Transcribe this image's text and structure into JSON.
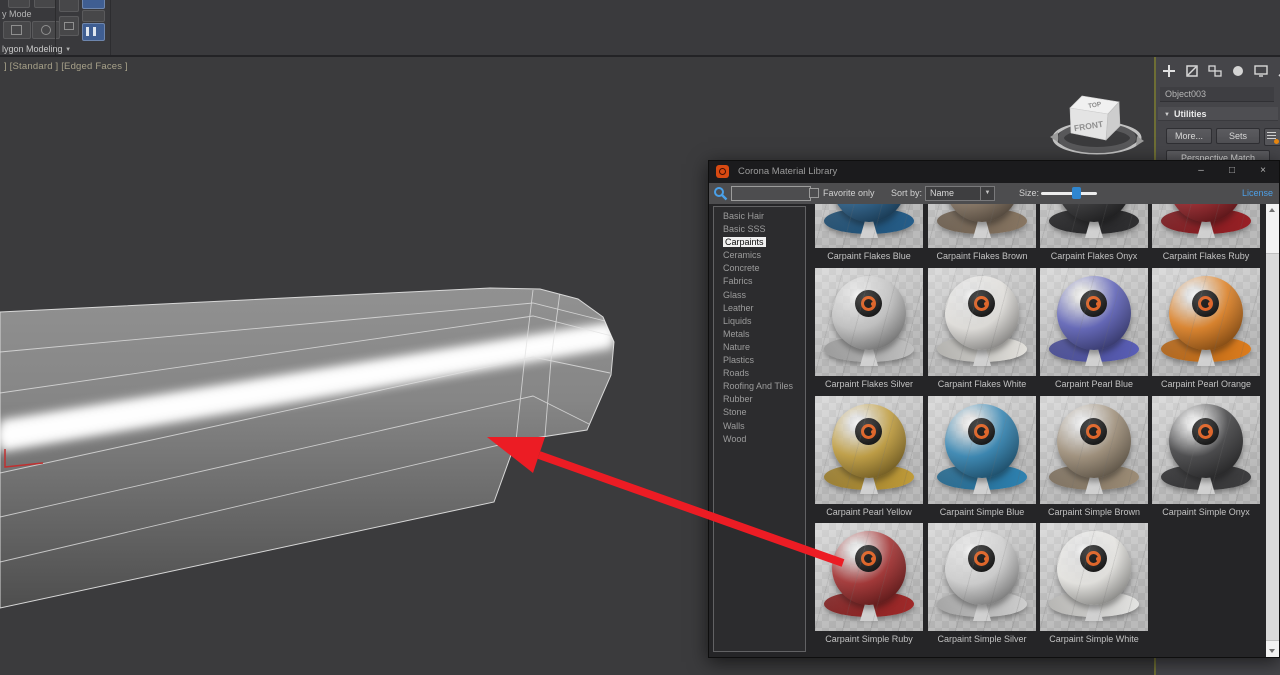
{
  "ribbon": {
    "mode_label": "y Mode",
    "tab_label": "lygon Modeling",
    "tab_arrow": "▼"
  },
  "viewport": {
    "shading_label": "]  [Standard ]  [Edged Faces ]"
  },
  "viewcube": {
    "top_label": "TOP",
    "front_label": "FRONT"
  },
  "command_panel": {
    "object_name": "Object003",
    "utilities_header": "Utilities",
    "more_button": "More...",
    "sets_button": "Sets",
    "perspective_match_button": "Perspective Match"
  },
  "library": {
    "window_title": "Corona Material Library",
    "window_controls": {
      "minimize": "–",
      "maximize": "□",
      "close": "×"
    },
    "search_value": "",
    "favorite_only_label": "Favorite only",
    "sort_by_label": "Sort by:",
    "sort_value": "Name",
    "size_label": "Size:",
    "license_link": "License",
    "selected_category": "Carpaints",
    "categories": [
      "Basic Hair",
      "Basic SSS",
      "Carpaints",
      "Ceramics",
      "Concrete",
      "Fabrics",
      "Glass",
      "Leather",
      "Liquids",
      "Metals",
      "Nature",
      "Plastics",
      "Roads",
      "Roofing And Tiles",
      "Rubber",
      "Stone",
      "Walls",
      "Wood"
    ],
    "materials": [
      {
        "name": "Carpaint Flakes Blue",
        "color": "#27618f"
      },
      {
        "name": "Carpaint Flakes Brown",
        "color": "#8d7a66"
      },
      {
        "name": "Carpaint Flakes Onyx",
        "color": "#303032"
      },
      {
        "name": "Carpaint Flakes Ruby",
        "color": "#9e2127"
      },
      {
        "name": "Carpaint Flakes Silver",
        "color": "#c8c8c8"
      },
      {
        "name": "Carpaint Flakes White",
        "color": "#eae8e4"
      },
      {
        "name": "Carpaint Pearl Blue",
        "color": "#5d61bd"
      },
      {
        "name": "Carpaint Pearl Orange",
        "color": "#e5811e"
      },
      {
        "name": "Carpaint Pearl Yellow",
        "color": "#c6a03a"
      },
      {
        "name": "Carpaint Simple Blue",
        "color": "#2f86b7"
      },
      {
        "name": "Carpaint Simple Brown",
        "color": "#a2917a"
      },
      {
        "name": "Carpaint Simple Onyx",
        "color": "#404042"
      },
      {
        "name": "Carpaint Simple Ruby",
        "color": "#a62b2b"
      },
      {
        "name": "Carpaint Simple Silver",
        "color": "#d6d6d6"
      },
      {
        "name": "Carpaint Simple White",
        "color": "#efeeea"
      }
    ]
  },
  "colors": {
    "corona_orange": "#e8560e",
    "link_blue": "#4d9fe6",
    "slider_blue": "#2f86d0",
    "arrow_red": "#ec1c24",
    "viewport_bg": "#3b3b3d",
    "window_bg": "#252527"
  }
}
